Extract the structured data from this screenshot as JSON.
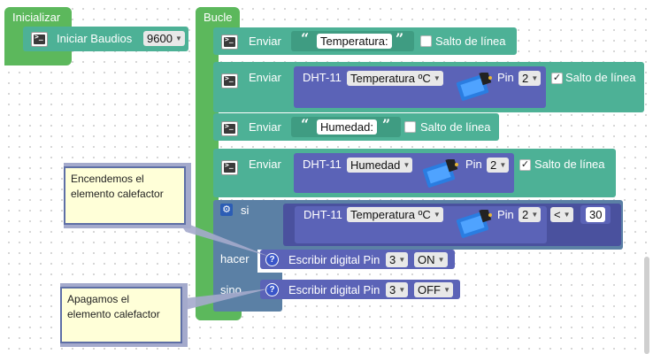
{
  "inicializar": {
    "title": "Inicializar",
    "label": "Iniciar  Baudios",
    "baud_value": "9600"
  },
  "bucle": {
    "title": "Bucle"
  },
  "row1": {
    "cmd": "Enviar",
    "text": "Temperatura:",
    "newline_label": "Salto de línea",
    "newline_checked": false
  },
  "row2": {
    "cmd": "Enviar",
    "sensor": "DHT-11",
    "measure": "Temperatura ºC",
    "pin_label": "Pin",
    "pin": "2",
    "newline_label": "Salto de línea",
    "newline_checked": true
  },
  "row3": {
    "cmd": "Enviar",
    "text": "Humedad:",
    "newline_label": "Salto de línea",
    "newline_checked": false
  },
  "row4": {
    "cmd": "Enviar",
    "sensor": "DHT-11",
    "measure": "Humedad",
    "pin_label": "Pin",
    "pin": "2",
    "newline_label": "Salto de línea",
    "newline_checked": true
  },
  "if_block": {
    "si_label": "si",
    "sensor": "DHT-11",
    "measure": "Temperatura ºC",
    "pin_label": "Pin",
    "pin": "2",
    "operator": "<",
    "threshold": "30",
    "hacer_label": "hacer",
    "hacer_action": "Escribir digital Pin",
    "hacer_pin": "3",
    "hacer_value": "ON",
    "sino_label": "sino",
    "sino_action": "Escribir digital Pin",
    "sino_pin": "3",
    "sino_value": "OFF"
  },
  "comments": [
    {
      "text": "Encendemos el elemento calefactor"
    },
    {
      "text": "Apagamos el elemento calefactor"
    }
  ],
  "quote_open": "“",
  "quote_close": "”",
  "colors": {
    "event_green": "#5cb85c",
    "serial_teal": "#4db196",
    "sensor_purple": "#5b63b7",
    "control_blue": "#5b80a5"
  }
}
